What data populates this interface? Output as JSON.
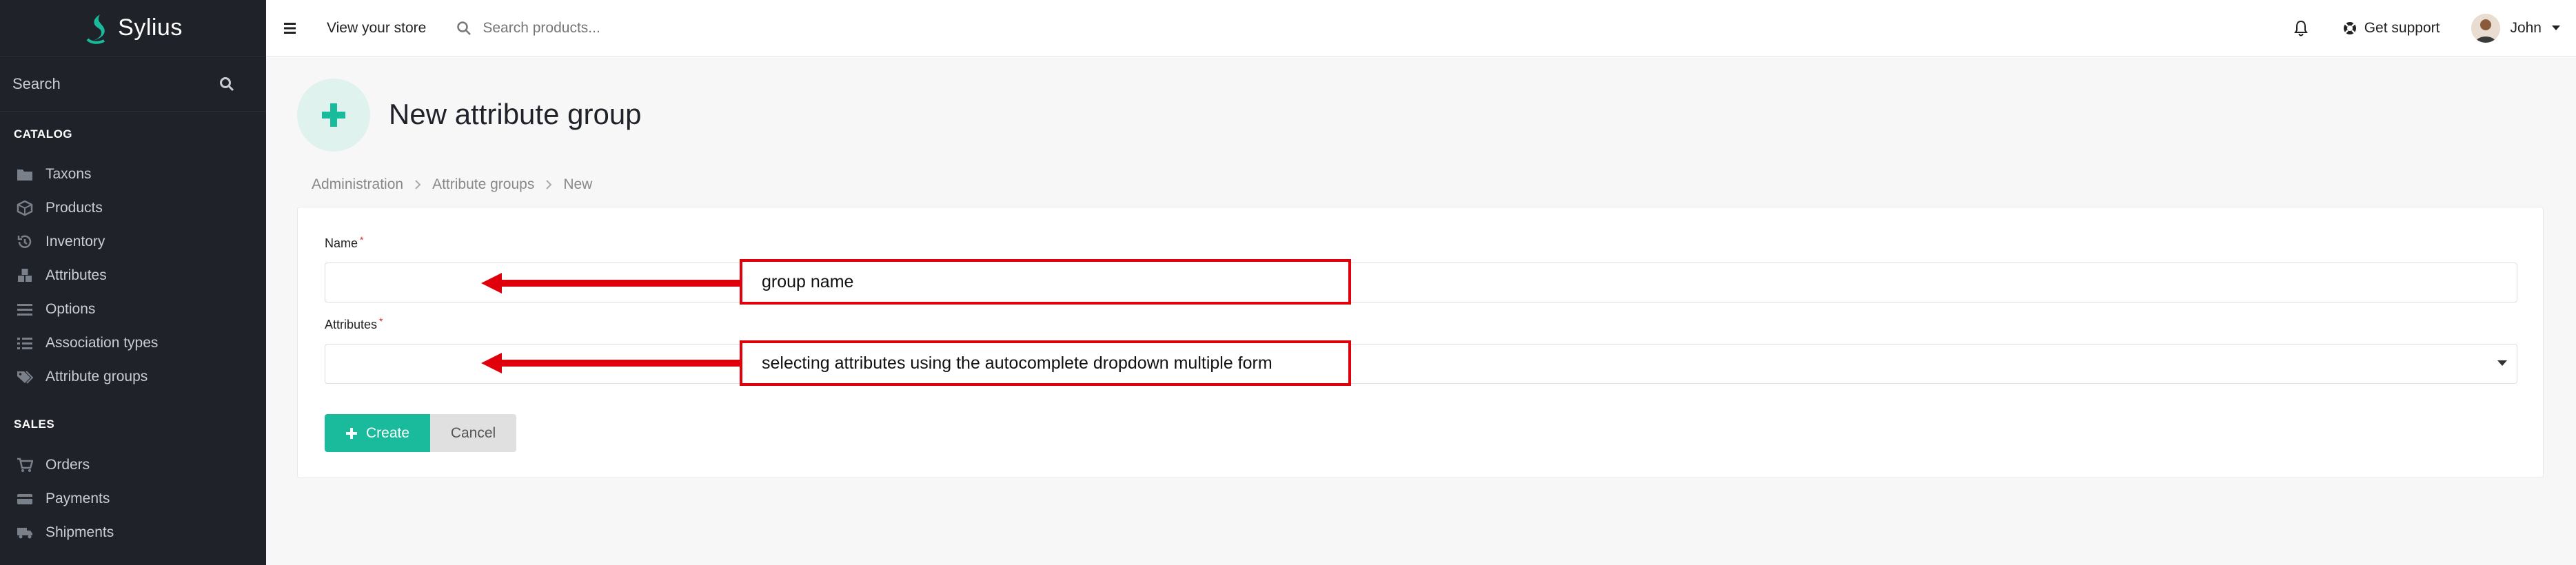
{
  "brand": {
    "name": "Sylius"
  },
  "sidebar": {
    "search_label": "Search",
    "sections": [
      {
        "title": "CATALOG",
        "items": [
          {
            "label": "Taxons",
            "icon": "folder-icon"
          },
          {
            "label": "Products",
            "icon": "cube-icon"
          },
          {
            "label": "Inventory",
            "icon": "history-icon"
          },
          {
            "label": "Attributes",
            "icon": "cubes-icon"
          },
          {
            "label": "Options",
            "icon": "options-icon"
          },
          {
            "label": "Association types",
            "icon": "list-icon"
          },
          {
            "label": "Attribute groups",
            "icon": "tags-icon"
          }
        ]
      },
      {
        "title": "SALES",
        "items": [
          {
            "label": "Orders",
            "icon": "cart-icon"
          },
          {
            "label": "Payments",
            "icon": "payment-icon"
          },
          {
            "label": "Shipments",
            "icon": "truck-icon"
          }
        ]
      }
    ]
  },
  "topbar": {
    "view_store": "View your store",
    "search_placeholder": "Search products...",
    "support": "Get support",
    "user": "John"
  },
  "page": {
    "title": "New attribute group",
    "breadcrumb": [
      "Administration",
      "Attribute groups",
      "New"
    ]
  },
  "form": {
    "name_label": "Name",
    "name_value": "",
    "attributes_label": "Attributes",
    "attributes_value": "",
    "required_mark": "*",
    "create_label": "Create",
    "cancel_label": "Cancel"
  },
  "annotations": {
    "name_note": "group name",
    "attributes_note": "selecting attributes using the autocomplete dropdown multiple form"
  },
  "colors": {
    "sidebar_bg": "#1f2229",
    "accent": "#1abb9c",
    "annotation": "#e0000b"
  }
}
